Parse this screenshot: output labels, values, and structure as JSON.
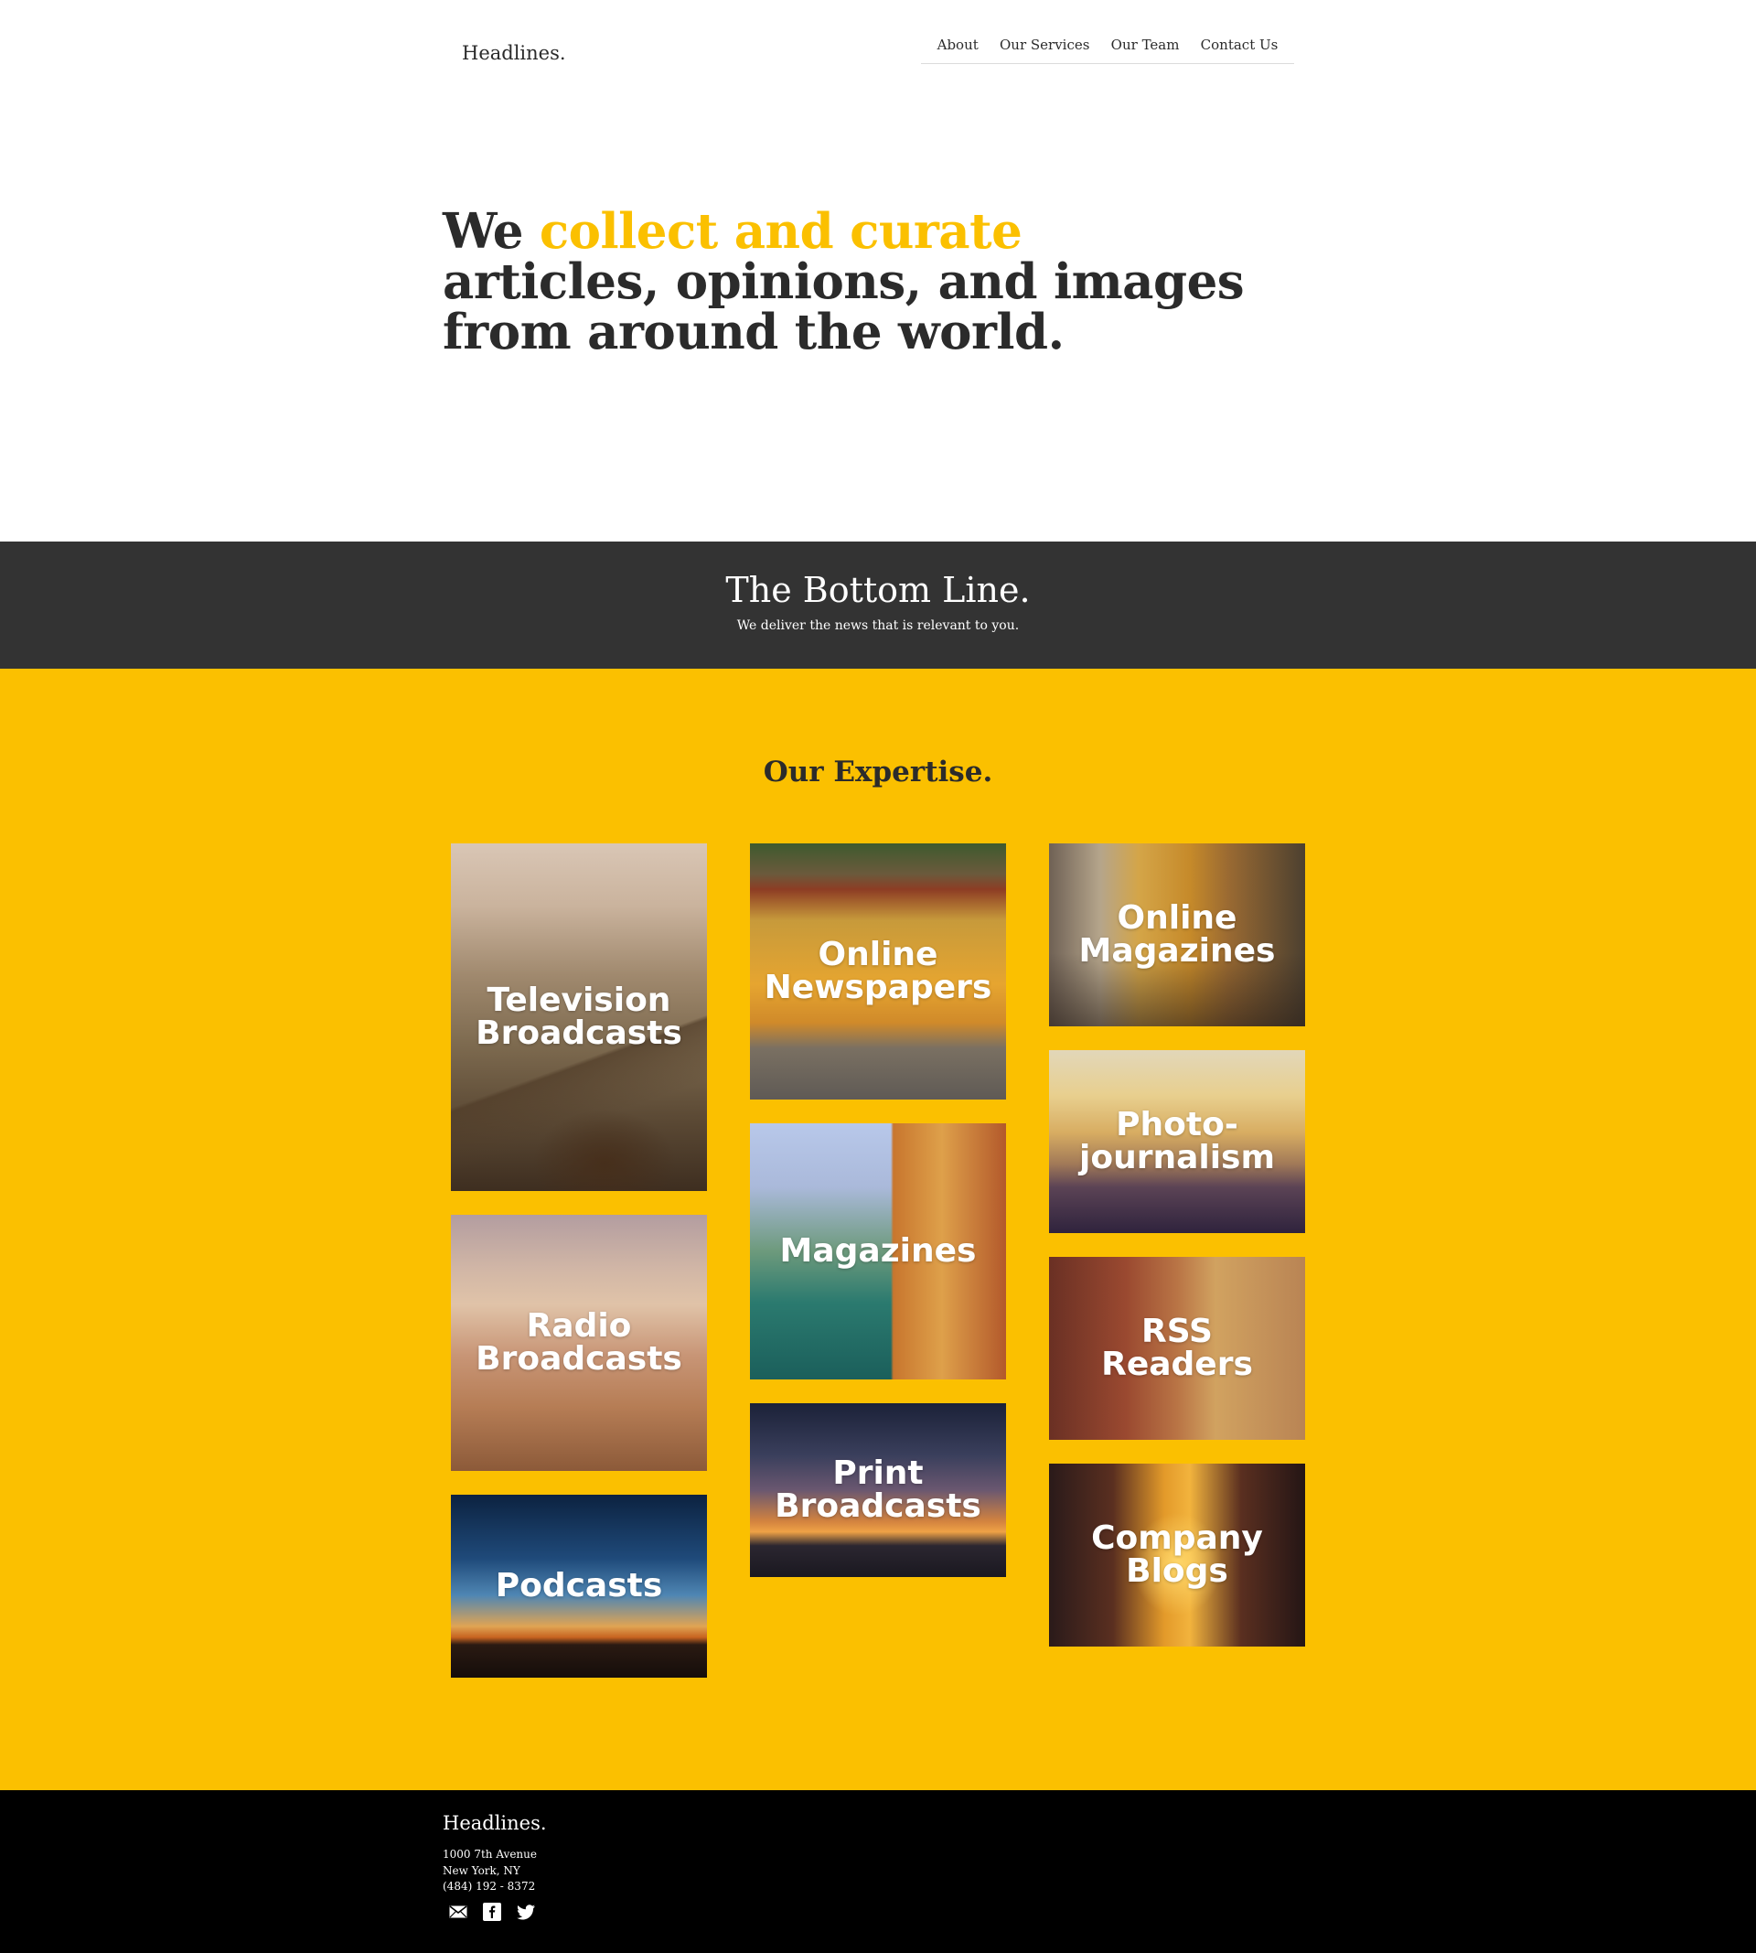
{
  "header": {
    "logo": "Headlines.",
    "nav": [
      "About",
      "Our Services",
      "Our Team",
      "Contact Us"
    ]
  },
  "hero": {
    "prefix": "We ",
    "accent": "collect and curate",
    "line2": "articles, opinions, and images",
    "line3": "from around the world."
  },
  "band": {
    "title": "The Bottom Line.",
    "subtitle": "We deliver the news that is relevant to you."
  },
  "expertise": {
    "title": "Our Expertise.",
    "tiles": {
      "tv": [
        "Television",
        "Broadcasts"
      ],
      "radio": [
        "Radio",
        "Broadcasts"
      ],
      "podcasts": [
        "Podcasts"
      ],
      "newspapers": [
        "Online",
        "Newspapers"
      ],
      "magazines": [
        "Magazines"
      ],
      "print": [
        "Print",
        "Broadcasts"
      ],
      "online_magazines": [
        "Online",
        "Magazines"
      ],
      "photojournalism": [
        "Photo-",
        "journalism"
      ],
      "rss": [
        "RSS",
        "Readers"
      ],
      "blogs": [
        "Company",
        "Blogs"
      ]
    }
  },
  "footer": {
    "brand": "Headlines.",
    "address": [
      "1000 7th Avenue",
      "New York, NY",
      "(484) 192 - 8372"
    ],
    "social": [
      "mail-icon",
      "facebook-icon",
      "twitter-icon"
    ]
  },
  "colors": {
    "accent": "#fbc000",
    "band": "#333333",
    "text": "#2b2b2b",
    "footer": "#000000"
  }
}
